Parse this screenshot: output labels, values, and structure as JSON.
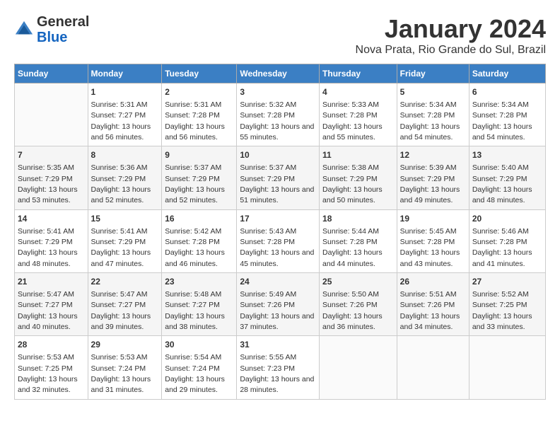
{
  "logo": {
    "general": "General",
    "blue": "Blue"
  },
  "title": "January 2024",
  "subtitle": "Nova Prata, Rio Grande do Sul, Brazil",
  "days_header": [
    "Sunday",
    "Monday",
    "Tuesday",
    "Wednesday",
    "Thursday",
    "Friday",
    "Saturday"
  ],
  "weeks": [
    [
      {
        "day": "",
        "sunrise": "",
        "sunset": "",
        "daylight": ""
      },
      {
        "day": "1",
        "sunrise": "Sunrise: 5:31 AM",
        "sunset": "Sunset: 7:27 PM",
        "daylight": "Daylight: 13 hours and 56 minutes."
      },
      {
        "day": "2",
        "sunrise": "Sunrise: 5:31 AM",
        "sunset": "Sunset: 7:28 PM",
        "daylight": "Daylight: 13 hours and 56 minutes."
      },
      {
        "day": "3",
        "sunrise": "Sunrise: 5:32 AM",
        "sunset": "Sunset: 7:28 PM",
        "daylight": "Daylight: 13 hours and 55 minutes."
      },
      {
        "day": "4",
        "sunrise": "Sunrise: 5:33 AM",
        "sunset": "Sunset: 7:28 PM",
        "daylight": "Daylight: 13 hours and 55 minutes."
      },
      {
        "day": "5",
        "sunrise": "Sunrise: 5:34 AM",
        "sunset": "Sunset: 7:28 PM",
        "daylight": "Daylight: 13 hours and 54 minutes."
      },
      {
        "day": "6",
        "sunrise": "Sunrise: 5:34 AM",
        "sunset": "Sunset: 7:28 PM",
        "daylight": "Daylight: 13 hours and 54 minutes."
      }
    ],
    [
      {
        "day": "7",
        "sunrise": "Sunrise: 5:35 AM",
        "sunset": "Sunset: 7:29 PM",
        "daylight": "Daylight: 13 hours and 53 minutes."
      },
      {
        "day": "8",
        "sunrise": "Sunrise: 5:36 AM",
        "sunset": "Sunset: 7:29 PM",
        "daylight": "Daylight: 13 hours and 52 minutes."
      },
      {
        "day": "9",
        "sunrise": "Sunrise: 5:37 AM",
        "sunset": "Sunset: 7:29 PM",
        "daylight": "Daylight: 13 hours and 52 minutes."
      },
      {
        "day": "10",
        "sunrise": "Sunrise: 5:37 AM",
        "sunset": "Sunset: 7:29 PM",
        "daylight": "Daylight: 13 hours and 51 minutes."
      },
      {
        "day": "11",
        "sunrise": "Sunrise: 5:38 AM",
        "sunset": "Sunset: 7:29 PM",
        "daylight": "Daylight: 13 hours and 50 minutes."
      },
      {
        "day": "12",
        "sunrise": "Sunrise: 5:39 AM",
        "sunset": "Sunset: 7:29 PM",
        "daylight": "Daylight: 13 hours and 49 minutes."
      },
      {
        "day": "13",
        "sunrise": "Sunrise: 5:40 AM",
        "sunset": "Sunset: 7:29 PM",
        "daylight": "Daylight: 13 hours and 48 minutes."
      }
    ],
    [
      {
        "day": "14",
        "sunrise": "Sunrise: 5:41 AM",
        "sunset": "Sunset: 7:29 PM",
        "daylight": "Daylight: 13 hours and 48 minutes."
      },
      {
        "day": "15",
        "sunrise": "Sunrise: 5:41 AM",
        "sunset": "Sunset: 7:29 PM",
        "daylight": "Daylight: 13 hours and 47 minutes."
      },
      {
        "day": "16",
        "sunrise": "Sunrise: 5:42 AM",
        "sunset": "Sunset: 7:28 PM",
        "daylight": "Daylight: 13 hours and 46 minutes."
      },
      {
        "day": "17",
        "sunrise": "Sunrise: 5:43 AM",
        "sunset": "Sunset: 7:28 PM",
        "daylight": "Daylight: 13 hours and 45 minutes."
      },
      {
        "day": "18",
        "sunrise": "Sunrise: 5:44 AM",
        "sunset": "Sunset: 7:28 PM",
        "daylight": "Daylight: 13 hours and 44 minutes."
      },
      {
        "day": "19",
        "sunrise": "Sunrise: 5:45 AM",
        "sunset": "Sunset: 7:28 PM",
        "daylight": "Daylight: 13 hours and 43 minutes."
      },
      {
        "day": "20",
        "sunrise": "Sunrise: 5:46 AM",
        "sunset": "Sunset: 7:28 PM",
        "daylight": "Daylight: 13 hours and 41 minutes."
      }
    ],
    [
      {
        "day": "21",
        "sunrise": "Sunrise: 5:47 AM",
        "sunset": "Sunset: 7:27 PM",
        "daylight": "Daylight: 13 hours and 40 minutes."
      },
      {
        "day": "22",
        "sunrise": "Sunrise: 5:47 AM",
        "sunset": "Sunset: 7:27 PM",
        "daylight": "Daylight: 13 hours and 39 minutes."
      },
      {
        "day": "23",
        "sunrise": "Sunrise: 5:48 AM",
        "sunset": "Sunset: 7:27 PM",
        "daylight": "Daylight: 13 hours and 38 minutes."
      },
      {
        "day": "24",
        "sunrise": "Sunrise: 5:49 AM",
        "sunset": "Sunset: 7:26 PM",
        "daylight": "Daylight: 13 hours and 37 minutes."
      },
      {
        "day": "25",
        "sunrise": "Sunrise: 5:50 AM",
        "sunset": "Sunset: 7:26 PM",
        "daylight": "Daylight: 13 hours and 36 minutes."
      },
      {
        "day": "26",
        "sunrise": "Sunrise: 5:51 AM",
        "sunset": "Sunset: 7:26 PM",
        "daylight": "Daylight: 13 hours and 34 minutes."
      },
      {
        "day": "27",
        "sunrise": "Sunrise: 5:52 AM",
        "sunset": "Sunset: 7:25 PM",
        "daylight": "Daylight: 13 hours and 33 minutes."
      }
    ],
    [
      {
        "day": "28",
        "sunrise": "Sunrise: 5:53 AM",
        "sunset": "Sunset: 7:25 PM",
        "daylight": "Daylight: 13 hours and 32 minutes."
      },
      {
        "day": "29",
        "sunrise": "Sunrise: 5:53 AM",
        "sunset": "Sunset: 7:24 PM",
        "daylight": "Daylight: 13 hours and 31 minutes."
      },
      {
        "day": "30",
        "sunrise": "Sunrise: 5:54 AM",
        "sunset": "Sunset: 7:24 PM",
        "daylight": "Daylight: 13 hours and 29 minutes."
      },
      {
        "day": "31",
        "sunrise": "Sunrise: 5:55 AM",
        "sunset": "Sunset: 7:23 PM",
        "daylight": "Daylight: 13 hours and 28 minutes."
      },
      {
        "day": "",
        "sunrise": "",
        "sunset": "",
        "daylight": ""
      },
      {
        "day": "",
        "sunrise": "",
        "sunset": "",
        "daylight": ""
      },
      {
        "day": "",
        "sunrise": "",
        "sunset": "",
        "daylight": ""
      }
    ]
  ]
}
